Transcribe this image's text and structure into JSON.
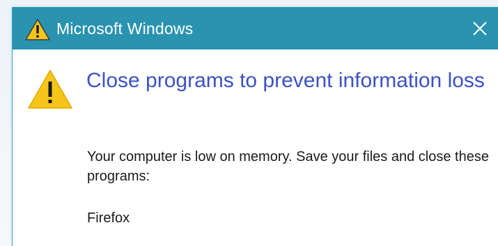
{
  "window": {
    "title": "Microsoft Windows",
    "title_icon": "warning-icon",
    "close_icon": "close-icon"
  },
  "dialog": {
    "icon": "warning-icon",
    "headline": "Close programs to prevent information loss",
    "message": "Your computer is low on memory. Save your files and close these programs:",
    "programs": [
      "Firefox"
    ]
  },
  "colors": {
    "titlebar": "#2a93b0",
    "headline": "#3b52c4",
    "warning_fill": "#f6c51a",
    "text": "#1a1a1a"
  }
}
